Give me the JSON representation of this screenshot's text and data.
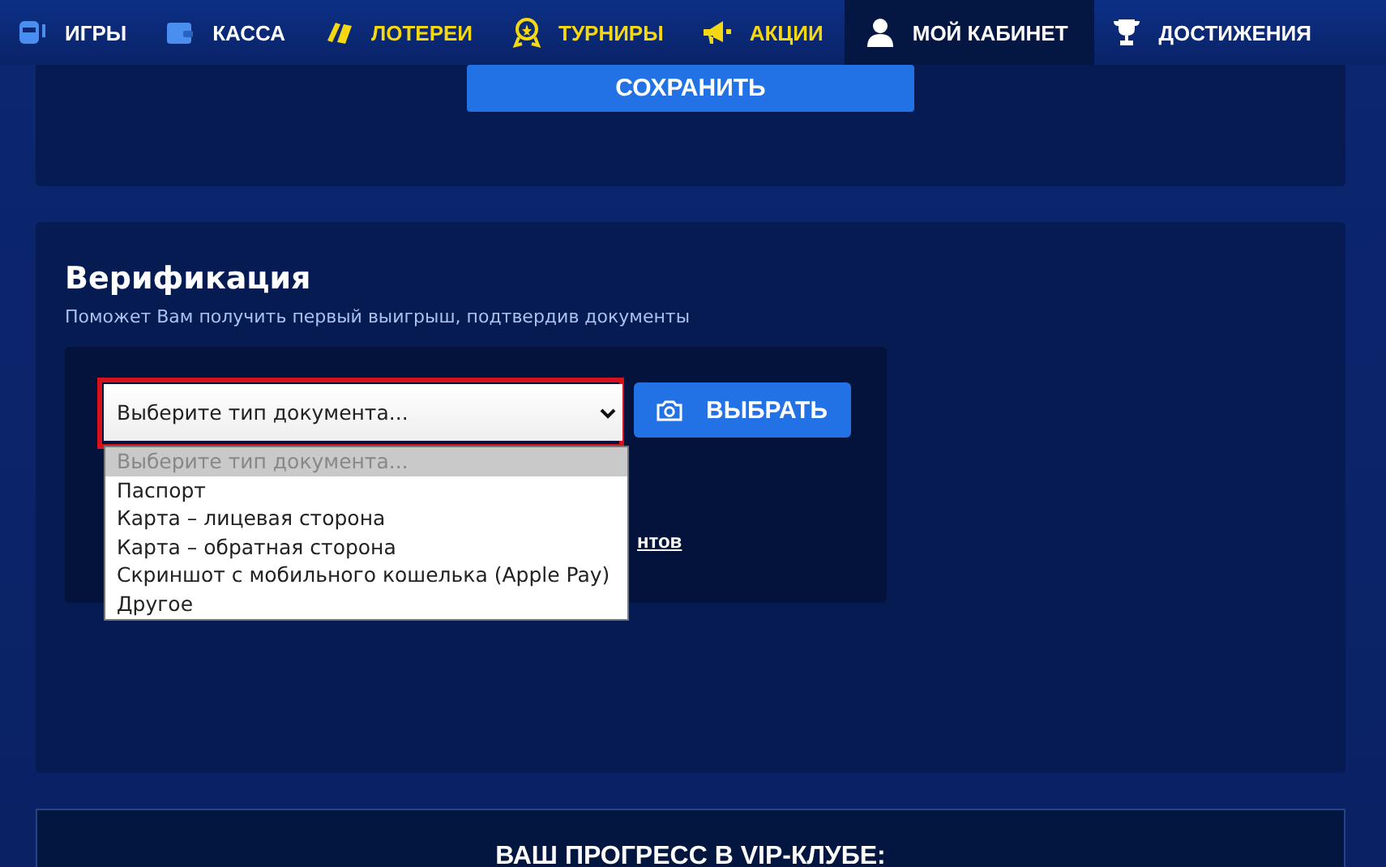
{
  "nav": {
    "items": [
      {
        "label": "ИГРЫ",
        "color": "#ffffff",
        "selected": false
      },
      {
        "label": "КАССА",
        "color": "#ffffff",
        "selected": false
      },
      {
        "label": "ЛОТЕРЕИ",
        "color": "#f5d712",
        "selected": false
      },
      {
        "label": "ТУРНИРЫ",
        "color": "#f5d712",
        "selected": false
      },
      {
        "label": "АКЦИИ",
        "color": "#f5d712",
        "selected": false
      },
      {
        "label": "МОЙ КАБИНЕТ",
        "color": "#ffffff",
        "selected": true
      },
      {
        "label": "ДОСТИЖЕНИЯ",
        "color": "#ffffff",
        "selected": false
      }
    ]
  },
  "profile": {
    "save_button": "СОХРАНИТЬ"
  },
  "verification": {
    "title": "Верификация",
    "subtitle": "Поможет Вам получить первый выигрыш, подтвердив документы",
    "document_select": {
      "value": "Выберите тип документа...",
      "expanded": true,
      "options": [
        {
          "label": "Выберите тип документа...",
          "disabled": true,
          "selected": true
        },
        {
          "label": "Паспорт",
          "disabled": false,
          "selected": false
        },
        {
          "label": "Карта – лицевая сторона",
          "disabled": false,
          "selected": false
        },
        {
          "label": "Карта – обратная сторона",
          "disabled": false,
          "selected": false
        },
        {
          "label": "Скриншот с мобильного кошелька (Apple Pay)",
          "disabled": false,
          "selected": false
        },
        {
          "label": "Другое",
          "disabled": false,
          "selected": false
        }
      ]
    },
    "choose_button": "ВЫБРАТЬ",
    "link_fragment": "нтов"
  },
  "vip": {
    "title": "ВАШ ПРОГРЕСС В VIP-КЛУБЕ:"
  }
}
